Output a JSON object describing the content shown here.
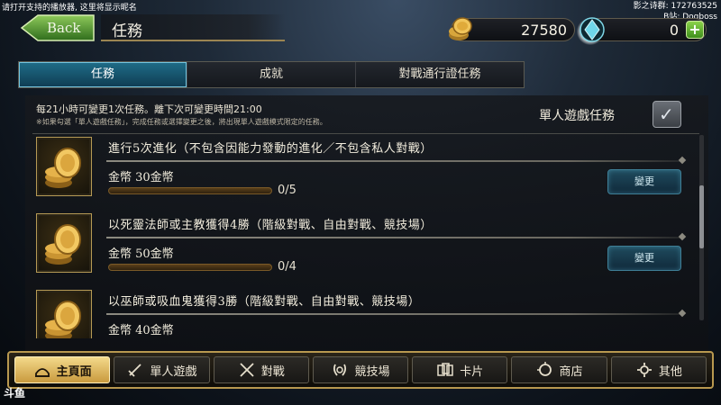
{
  "stream": {
    "top_left_notice": "请打开支持的播放器, 这里将显示昵名",
    "top_right_line1": "影之诗群: 172763525",
    "top_right_line2": "B站: Dogboss"
  },
  "header": {
    "back_label": "Back",
    "title": "任務",
    "gold": "27580",
    "crystals": "0",
    "plus_label": "+"
  },
  "tabs": [
    {
      "label": "任務",
      "active": true
    },
    {
      "label": "成就",
      "active": false
    },
    {
      "label": "對戰通行證任務",
      "active": false
    }
  ],
  "info": {
    "refresh_line": "每21小時可變更1次任務。離下次可變更時間21:00",
    "note": "※如果勾選「單人遊戲任務」，完成任務或選擇變更之後，將出現單人遊戲模式限定的任務。",
    "solo_label": "單人遊戲任務",
    "solo_checked": true,
    "check_mark": "✓"
  },
  "missions": [
    {
      "title": "進行5次進化（不包含因能力發動的進化／不包含私人對戰）",
      "reward": "金幣  30金幣",
      "progress": "0/5",
      "progress_fraction": 0,
      "change_label": "變更"
    },
    {
      "title": "以死靈法師或主教獲得4勝（階級對戰、自由對戰、競技場）",
      "reward": "金幣  50金幣",
      "progress": "0/4",
      "progress_fraction": 0,
      "change_label": "變更"
    },
    {
      "title": "以巫師或吸血鬼獲得3勝（階級對戰、自由對戰、競技場）",
      "reward": "金幣  40金幣",
      "progress": "",
      "progress_fraction": 0,
      "change_label": ""
    }
  ],
  "nav": [
    {
      "label": "主頁面",
      "icon": "home-icon",
      "active": true
    },
    {
      "label": "單人遊戲",
      "icon": "sword-icon",
      "active": false
    },
    {
      "label": "對戰",
      "icon": "crossed-swords-icon",
      "active": false
    },
    {
      "label": "競技場",
      "icon": "laurel-icon",
      "active": false
    },
    {
      "label": "卡片",
      "icon": "cards-icon",
      "active": false
    },
    {
      "label": "商店",
      "icon": "shop-icon",
      "active": false
    },
    {
      "label": "其他",
      "icon": "gear-icon",
      "active": false
    }
  ],
  "corner_logo": "斗鱼",
  "colors": {
    "active_tab": "#1f6d88",
    "nav_active": "#f3d98a",
    "gold_trim": "#b8984f",
    "progress": "#f0c060"
  }
}
